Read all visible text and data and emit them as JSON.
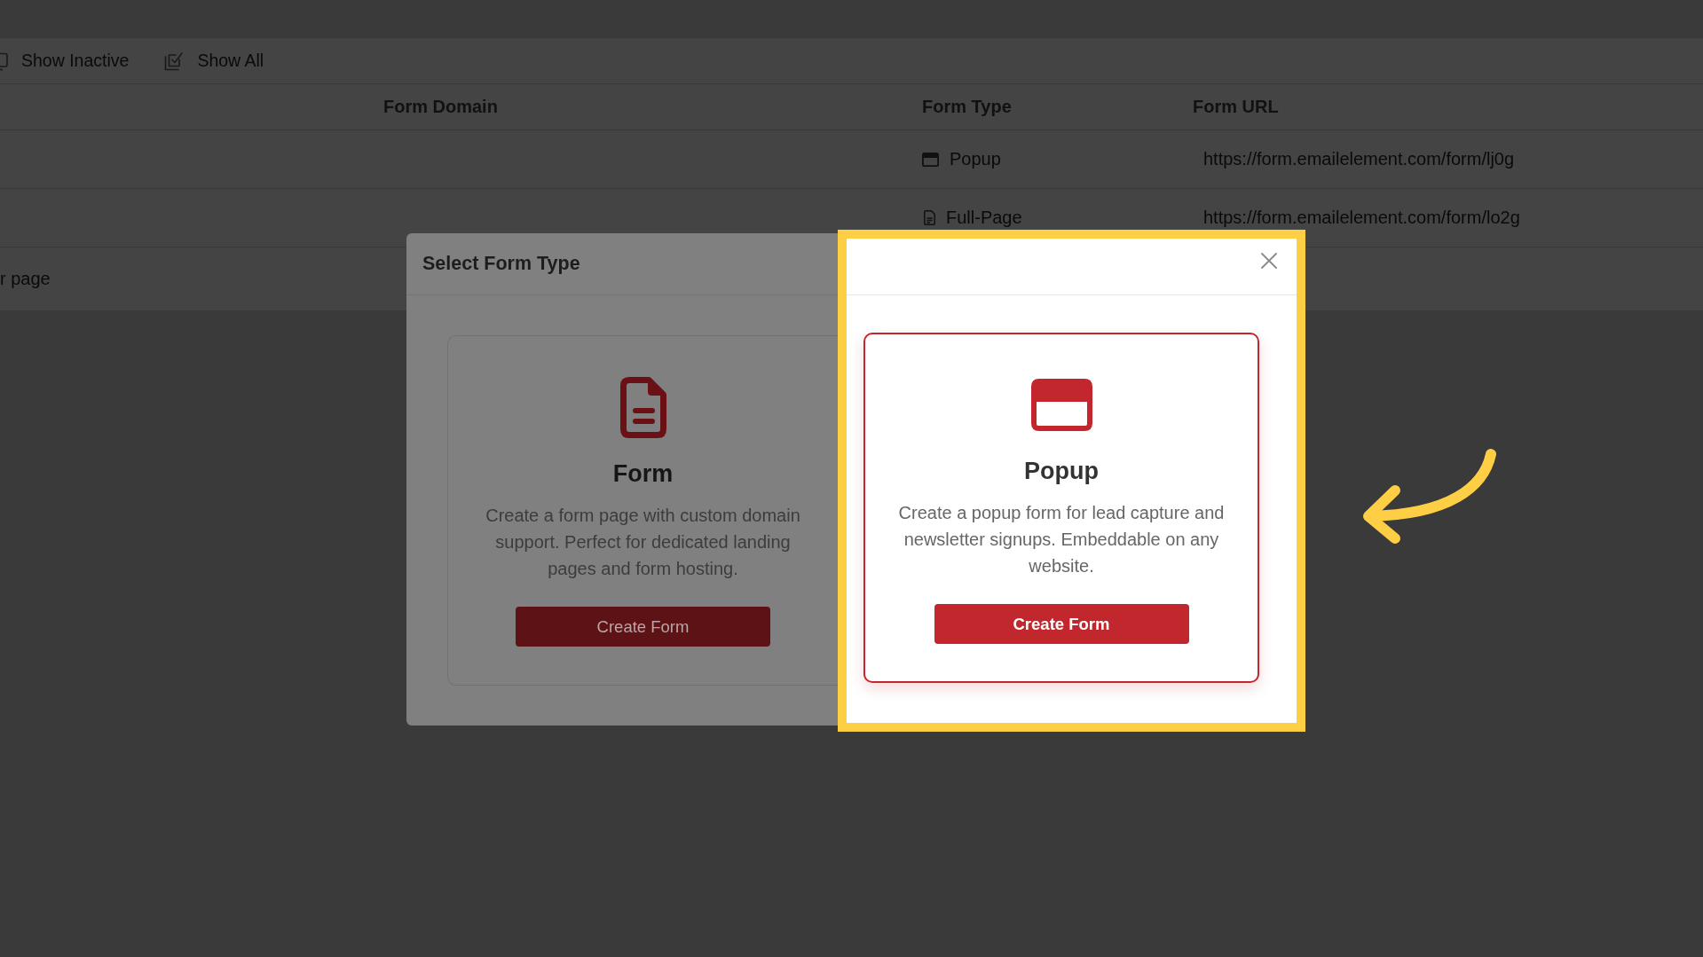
{
  "toolbar": {
    "buttons": [
      {
        "label": "Show Inactive"
      },
      {
        "label": "Show All"
      }
    ]
  },
  "table": {
    "columns": [
      "Form Domain",
      "Form Type",
      "Form URL"
    ],
    "rows": [
      {
        "kind": "popup",
        "form_type": "Popup",
        "form_url": "https://form.emailelement.com/form/lj0g"
      },
      {
        "kind": "page",
        "form_type": "Full-Page",
        "form_url": "https://form.emailelement.com/form/lo2g"
      }
    ],
    "footer_text": "r page"
  },
  "dialog": {
    "title": "Select Form Type",
    "cards": [
      {
        "kind": "page",
        "title": "Form",
        "description": "Create a form page with custom domain support. Perfect for dedicated landing pages and form hosting.",
        "button": "Create Form",
        "selected": false,
        "highlighted": false
      },
      {
        "kind": "popup",
        "title": "Popup",
        "description": "Create a popup form for lead capture and newsletter signups. Embeddable on any website.",
        "button": "Create Form",
        "selected": true,
        "highlighted": true
      }
    ]
  }
}
